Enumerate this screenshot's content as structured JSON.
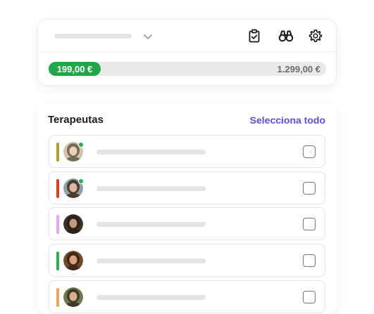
{
  "toolbar": {
    "icons": [
      "chevron-down-icon",
      "clipboard-check-icon",
      "binoculars-icon",
      "gear-icon"
    ]
  },
  "budget": {
    "current_label": "199,00 €",
    "max_label": "1.299,00 €",
    "progress_fraction": 0.153,
    "fill_color": "#22a64a"
  },
  "therapists": {
    "title": "Terapeutas",
    "select_all_label": "Selecciona todo",
    "accent_color": "#5b4fe0",
    "rows": [
      {
        "color": "#b5a01f",
        "online": true,
        "checked": false
      },
      {
        "color": "#e53d1c",
        "online": true,
        "checked": false
      },
      {
        "color": "#e7a3ef",
        "online": false,
        "checked": false
      },
      {
        "color": "#27b34b",
        "online": false,
        "checked": false
      },
      {
        "color": "#f2a35a",
        "online": false,
        "checked": false
      }
    ]
  }
}
